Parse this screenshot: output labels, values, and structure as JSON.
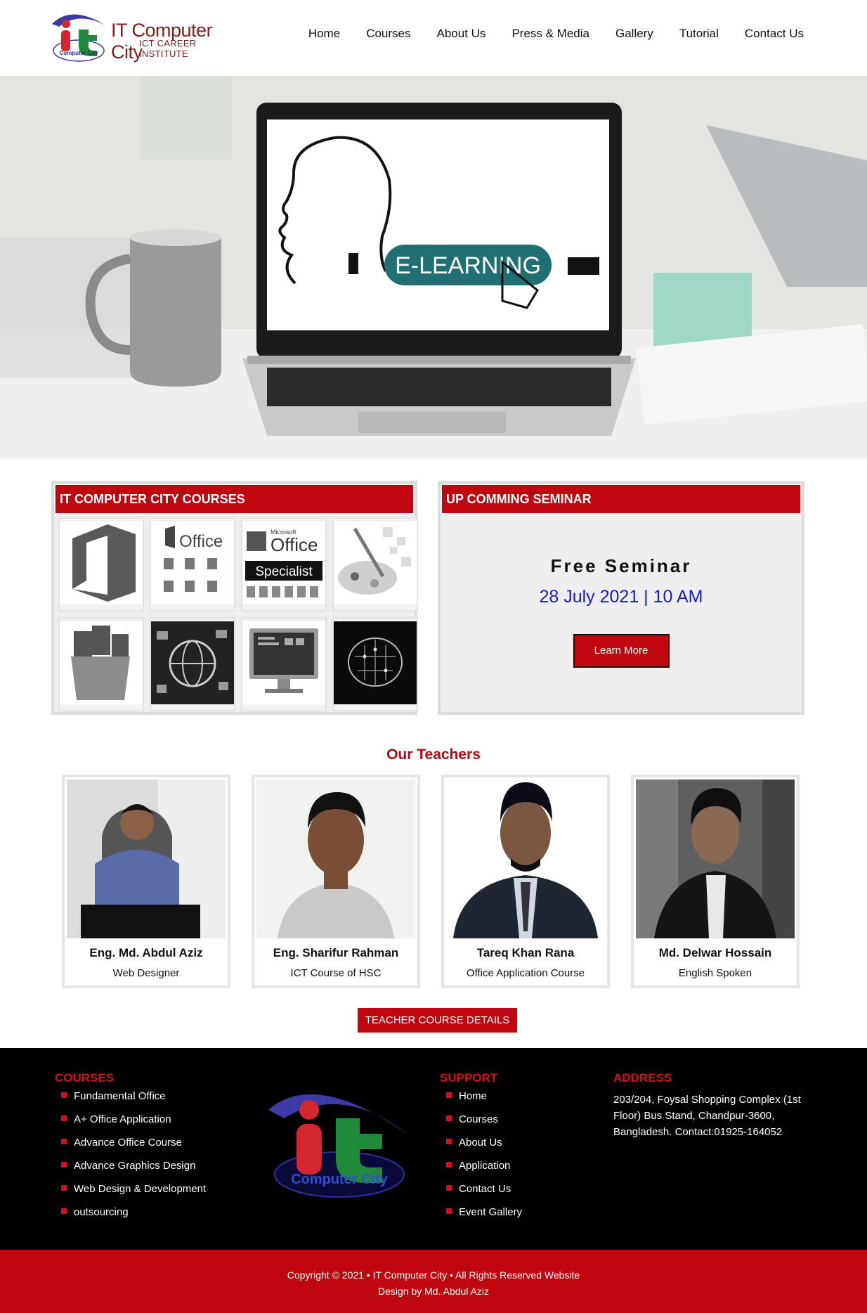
{
  "brand": {
    "name": "IT Computer City",
    "tagline": "ICT CAREER INSTITUTE",
    "logo_text": "Computer City",
    "colors": {
      "primary": "#c0070f",
      "text": "#111111",
      "link_blue": "#1a1acf"
    }
  },
  "nav": {
    "items": [
      "Home",
      "Courses",
      "About Us",
      "Press & Media",
      "Gallery",
      "Tutorial",
      "Contact Us"
    ]
  },
  "hero": {
    "screen_text": "E-LEARNING"
  },
  "courses": {
    "heading": "IT COMPUTER CITY COURSES",
    "tiles": [
      {
        "icon": "office-logo-icon"
      },
      {
        "icon": "office-apps-icon",
        "text": "Office"
      },
      {
        "icon": "office-specialist-icon",
        "text1": "Microsoft",
        "text2": "Office",
        "text3": "Specialist"
      },
      {
        "icon": "graphics-palette-icon"
      },
      {
        "icon": "software-box-icon"
      },
      {
        "icon": "globe-web-icon"
      },
      {
        "icon": "computer-monitor-icon"
      },
      {
        "icon": "circuit-brain-icon"
      }
    ]
  },
  "seminar": {
    "heading": "UP COMMING SEMINAR",
    "title": "Free Seminar",
    "date": "28 July 2021 | 10 AM",
    "button": "Learn More"
  },
  "teachers": {
    "heading": "Our Teachers",
    "list": [
      {
        "name": "Eng. Md. Abdul Aziz",
        "role": "Web Designer"
      },
      {
        "name": "Eng. Sharifur Rahman",
        "role": "ICT Course of HSC"
      },
      {
        "name": "Tareq Khan Rana",
        "role": "Office Application Course"
      },
      {
        "name": "Md. Delwar Hossain",
        "role": "English Spoken"
      }
    ],
    "button": "TEACHER COURSE DETAILS"
  },
  "footer": {
    "courses_heading": "COURSES",
    "courses": [
      "Fundamental Office",
      "A+ Office Application",
      "Advance Office Course",
      "Advance Graphics Design",
      "Web Design & Development",
      "outsourcing"
    ],
    "support_heading": "SUPPORT",
    "support": [
      "Home",
      "Courses",
      "About Us",
      "Application",
      "Contact Us",
      "Event Gallery"
    ],
    "address_heading": "ADDRESS",
    "address": "203/204, Foysal Shopping Complex (1st Floor) Bus Stand, Chandpur-3600, Bangladesh. Contact:01925-164052"
  },
  "copyright": {
    "line1": "Copyright © 2021 • IT Computer City • All Rights Reserved Website",
    "line2": "Design by Md. Abdul Aziz"
  }
}
